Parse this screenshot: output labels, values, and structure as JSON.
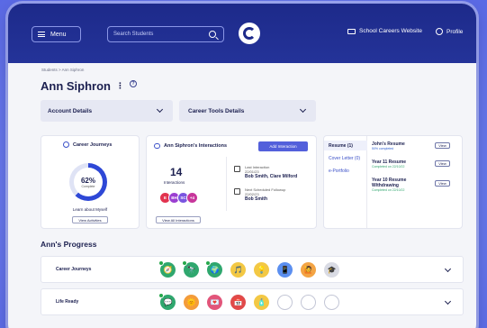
{
  "header": {
    "menu_label": "Menu",
    "search_placeholder": "Search Students",
    "website_label": "School Careers Website",
    "profile_label": "Profile"
  },
  "breadcrumb": "Students > Ann Siphron",
  "page_title": "Ann Siphron",
  "dropdowns": {
    "account": "Account Details",
    "career_tools": "Career Tools Details"
  },
  "career_journeys": {
    "title": "Career Journeys",
    "percent_value": 0.62,
    "percent_label": "62%",
    "percent_sub": "Complete",
    "journey_name": "Learn about Myself",
    "view_button": "View Activities"
  },
  "interactions": {
    "title": "Ann Siphron's Interactions",
    "add_button": "Add Interaction",
    "count": "14",
    "count_label": "Interactions",
    "avatars": [
      {
        "initials": "E",
        "color": "#e2334f"
      },
      {
        "initials": "BH",
        "color": "#9b3fd1"
      },
      {
        "initials": "SC",
        "color": "#7a55e0"
      },
      {
        "initials": "+4",
        "color": "#c7369b"
      }
    ],
    "last_label": "Last Interaction",
    "last_date": "22/01/23",
    "last_people": "Bob Smith, Clare Milford",
    "next_label": "Next Scheduled Followup",
    "next_date": "22/02/23",
    "next_person": "Bob Smith",
    "view_all_button": "View All Interactions"
  },
  "resumes": {
    "tabs": [
      "Resume (1)",
      "Cover Letter (0)",
      "e-Portfolio"
    ],
    "items": [
      {
        "name": "John's Resume",
        "status": "50% completed",
        "button": "View"
      },
      {
        "name": "Year 11 Resume",
        "status": "Completed on 22/10/22",
        "button": "View"
      },
      {
        "name": "Year 10 Resume Withdrawing",
        "status": "Completed on 22/10/22",
        "button": "View"
      }
    ]
  },
  "progress": {
    "title": "Ann's Progress",
    "rows": [
      {
        "label": "Career Journeys",
        "badges": [
          {
            "icon": "🧭",
            "color": "#2fa76e",
            "done": true
          },
          {
            "icon": "🔭",
            "color": "#2fa76e",
            "done": true
          },
          {
            "icon": "🌍",
            "color": "#2fa76e",
            "done": true
          },
          {
            "icon": "🎵",
            "color": "#f3c844",
            "done": false
          },
          {
            "icon": "💡",
            "color": "#f3c844",
            "done": false
          },
          {
            "icon": "📱",
            "color": "#5b8ff0",
            "done": false
          },
          {
            "icon": "🙋",
            "color": "#f3a444",
            "done": false
          },
          {
            "icon": "🎓",
            "color": "#d9dbe4",
            "done": false
          }
        ]
      },
      {
        "label": "Life Ready",
        "badges": [
          {
            "icon": "💬",
            "color": "#2fa76e",
            "done": true
          },
          {
            "icon": "🌞",
            "color": "#f49c3a",
            "done": false
          },
          {
            "icon": "💌",
            "color": "#e2557a",
            "done": false
          },
          {
            "icon": "📅",
            "color": "#e04a4a",
            "done": false
          },
          {
            "icon": "🧴",
            "color": "#f3c844",
            "done": false
          },
          {
            "icon": "",
            "color": "",
            "done": false
          },
          {
            "icon": "",
            "color": "",
            "done": false
          },
          {
            "icon": "",
            "color": "",
            "done": false
          }
        ]
      }
    ]
  }
}
